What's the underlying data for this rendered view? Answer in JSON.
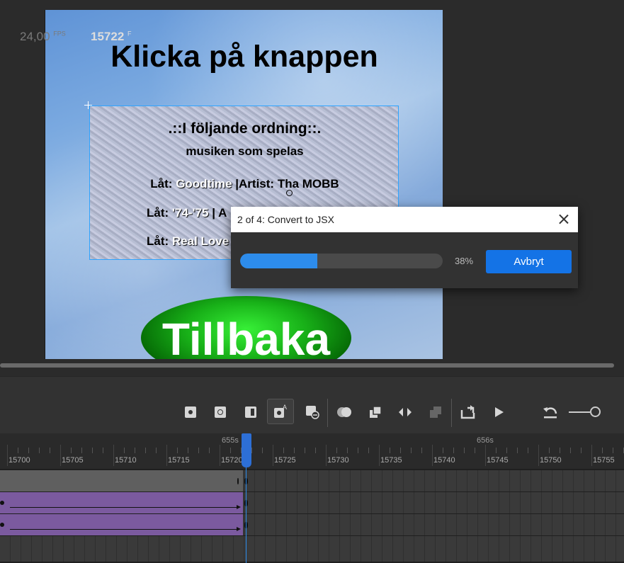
{
  "stage": {
    "title": "Klicka på knappen",
    "info": {
      "heading": ".::I följande ordning::.",
      "subheading": "musiken som spelas",
      "songs": [
        {
          "label": "Låt:",
          "song": "Goodtime",
          "sep": "|",
          "artist_label": "Artist:",
          "artist": "Tha MOBB"
        },
        {
          "label": "Låt:",
          "song": "'74-'75",
          "sep": "|",
          "artist_label": "A"
        },
        {
          "label": "Låt:",
          "song": "Real Love"
        }
      ]
    },
    "back_button": "Tillbaka"
  },
  "dialog": {
    "title": "2 of 4: Convert to JSX",
    "progress": 38,
    "progress_text": "38%",
    "cancel": "Avbryt"
  },
  "timeline": {
    "fps": "24,00",
    "fps_unit": "FPS",
    "current_frame": "15722",
    "frame_unit": "F",
    "seconds": [
      "655s",
      "656s"
    ],
    "frames": [
      "15700",
      "15705",
      "15710",
      "15715",
      "15720",
      "15725",
      "15730",
      "15735",
      "15740",
      "15745",
      "15750",
      "15755"
    ],
    "playhead_frame": 15722,
    "accent": "#2d8ceb"
  }
}
